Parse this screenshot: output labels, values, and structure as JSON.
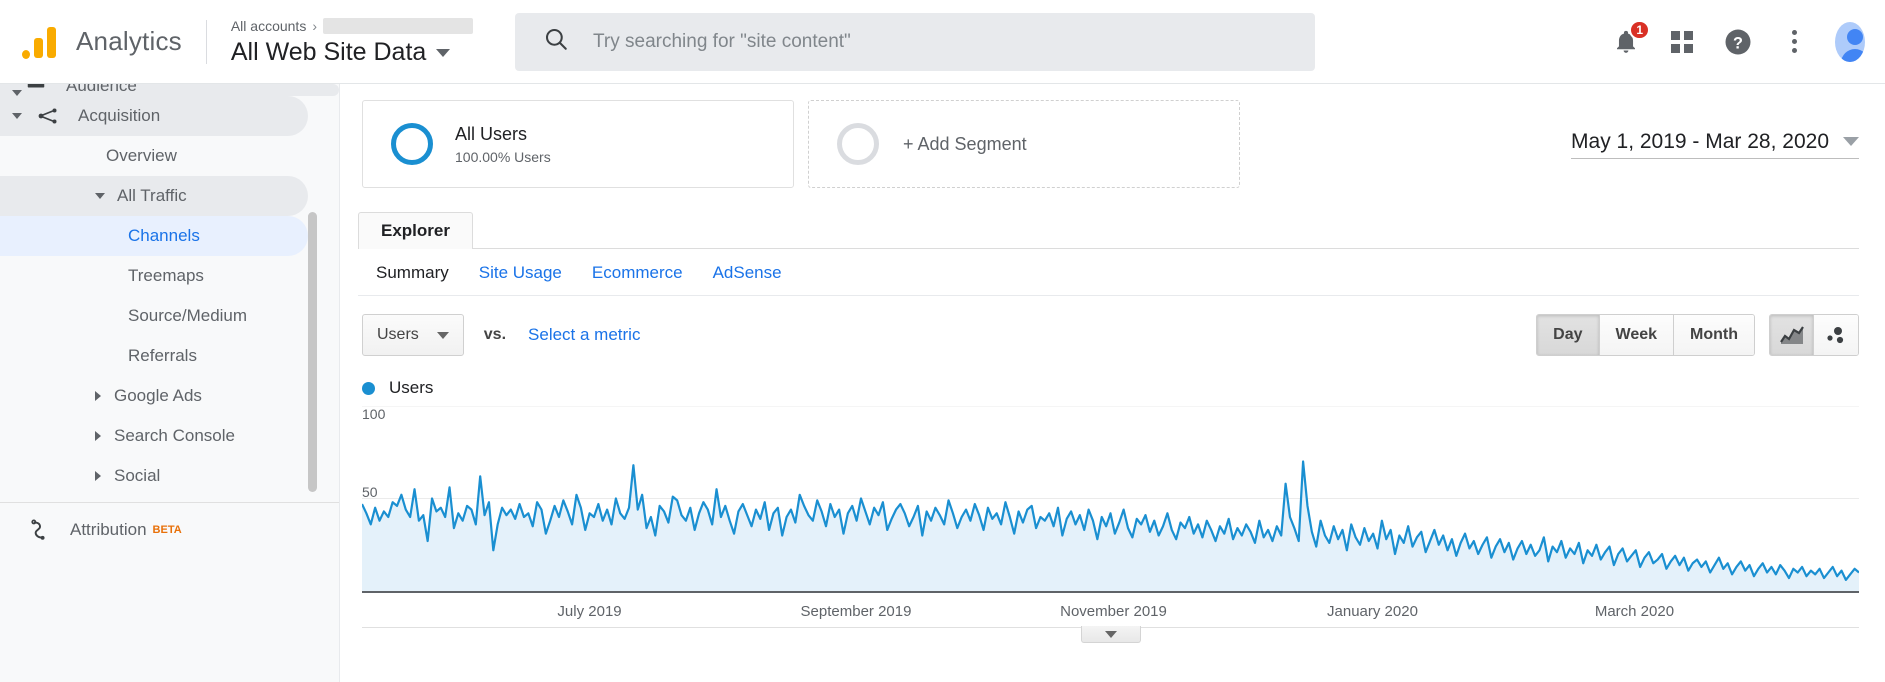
{
  "header": {
    "brand": "Analytics",
    "logo_icon": "analytics-logo",
    "breadcrumb_root": "All accounts",
    "breadcrumb_separator": "›",
    "property_name": "All Web Site Data",
    "search_placeholder": "Try searching for \"site content\"",
    "search_value": "",
    "search_icon": "search-icon",
    "notifications_icon": "bell-icon",
    "notifications_count": "1",
    "apps_icon": "grid-apps-icon",
    "help_icon": "help-question-icon",
    "more_icon": "kebab-menu-icon",
    "account_icon": "user-avatar-icon"
  },
  "sidebar": {
    "cut_top_item": "Audience",
    "items": [
      {
        "label": "Acquisition",
        "level": 0,
        "state": "group",
        "expander": "caret-down",
        "icon": "acquisition-icon"
      },
      {
        "label": "Overview",
        "level": 1,
        "state": "normal",
        "expander": "none",
        "icon": ""
      },
      {
        "label": "All Traffic",
        "level": 2,
        "state": "group",
        "expander": "caret-down",
        "icon": ""
      },
      {
        "label": "Channels",
        "level": 3,
        "state": "selected",
        "expander": "none",
        "icon": ""
      },
      {
        "label": "Treemaps",
        "level": 3,
        "state": "normal",
        "expander": "none",
        "icon": ""
      },
      {
        "label": "Source/Medium",
        "level": 3,
        "state": "normal",
        "expander": "none",
        "icon": ""
      },
      {
        "label": "Referrals",
        "level": 3,
        "state": "normal",
        "expander": "none",
        "icon": ""
      },
      {
        "label": "Google Ads",
        "level": 2,
        "state": "normal",
        "expander": "caret-right",
        "icon": ""
      },
      {
        "label": "Search Console",
        "level": 2,
        "state": "normal",
        "expander": "caret-right",
        "icon": ""
      },
      {
        "label": "Social",
        "level": 2,
        "state": "normal",
        "expander": "caret-right",
        "icon": ""
      }
    ],
    "footer_item": {
      "label": "Attribution",
      "badge": "BETA",
      "icon": "attribution-icon"
    }
  },
  "segments": {
    "primary": {
      "name": "All Users",
      "detail": "100.00% Users",
      "ring_color": "#1a8fd1"
    },
    "add_label": "+ Add Segment"
  },
  "date_range": {
    "label": "May 1, 2019 - Mar 28, 2020",
    "caret": "chevron-down-icon"
  },
  "tabs": {
    "main": "Explorer",
    "sub": [
      "Summary",
      "Site Usage",
      "Ecommerce",
      "AdSense"
    ],
    "sub_active": "Summary"
  },
  "controls": {
    "metric_label": "Users",
    "vs_label": "vs.",
    "select_metric_label": "Select a metric",
    "granularity": [
      "Day",
      "Week",
      "Month"
    ],
    "granularity_active": "Day",
    "chart_types": [
      "line-chart-icon",
      "motion-chart-icon"
    ],
    "chart_type_active": "line-chart-icon"
  },
  "chart_data": {
    "type": "line",
    "title": "Users",
    "legend": [
      "Users"
    ],
    "legend_position": "top-left",
    "series_color": "#1a8fd1",
    "fill_color": "#e4f1fa",
    "xlabel": "",
    "ylabel": "",
    "ylim": [
      0,
      100
    ],
    "yticks": [
      50,
      100
    ],
    "grid": true,
    "x_tick_labels": [
      "July 2019",
      "September 2019",
      "November 2019",
      "January 2020",
      "March 2020"
    ],
    "x_tick_positions_pct": [
      15.2,
      33.0,
      50.2,
      67.5,
      85.0
    ],
    "x_range": [
      "May 1, 2019",
      "Mar 28, 2020"
    ],
    "values": [
      47,
      42,
      36,
      45,
      38,
      43,
      40,
      48,
      46,
      52,
      44,
      40,
      55,
      38,
      41,
      27,
      50,
      43,
      45,
      40,
      56,
      34,
      42,
      38,
      46,
      44,
      36,
      62,
      41,
      48,
      22,
      36,
      45,
      41,
      44,
      39,
      47,
      40,
      42,
      35,
      48,
      44,
      31,
      38,
      46,
      40,
      49,
      43,
      36,
      52,
      45,
      33,
      42,
      40,
      47,
      38,
      44,
      36,
      50,
      42,
      39,
      45,
      68,
      44,
      52,
      34,
      40,
      30,
      46,
      43,
      37,
      51,
      49,
      41,
      38,
      45,
      33,
      42,
      48,
      44,
      36,
      55,
      40,
      46,
      38,
      31,
      43,
      47,
      41,
      35,
      44,
      39,
      48,
      33,
      42,
      45,
      30,
      40,
      44,
      37,
      52,
      46,
      41,
      38,
      49,
      43,
      35,
      47,
      40,
      44,
      31,
      42,
      46,
      38,
      50,
      43,
      36,
      45,
      41,
      48,
      33,
      39,
      44,
      47,
      42,
      35,
      40,
      46,
      30,
      43,
      38,
      45,
      41,
      36,
      49,
      42,
      34,
      40,
      44,
      38,
      47,
      41,
      33,
      45,
      39,
      42,
      36,
      48,
      40,
      31,
      43,
      37,
      44,
      46,
      34,
      40,
      38,
      42,
      35,
      45,
      30,
      39,
      43,
      36,
      41,
      33,
      44,
      38,
      28,
      40,
      35,
      42,
      31,
      37,
      44,
      34,
      29,
      39,
      36,
      41,
      32,
      38,
      30,
      35,
      42,
      33,
      28,
      37,
      34,
      40,
      31,
      36,
      29,
      38,
      33,
      27,
      35,
      31,
      39,
      28,
      34,
      30,
      36,
      32,
      26,
      38,
      29,
      33,
      27,
      35,
      30,
      58,
      40,
      34,
      27,
      70,
      46,
      32,
      24,
      38,
      30,
      26,
      35,
      28,
      33,
      22,
      36,
      29,
      25,
      34,
      27,
      31,
      23,
      38,
      28,
      33,
      20,
      30,
      26,
      35,
      24,
      29,
      32,
      21,
      27,
      33,
      25,
      30,
      22,
      28,
      19,
      26,
      31,
      23,
      27,
      20,
      25,
      29,
      18,
      24,
      28,
      21,
      26,
      17,
      23,
      27,
      20,
      25,
      19,
      22,
      29,
      16,
      24,
      21,
      27,
      18,
      23,
      20,
      26,
      15,
      22,
      19,
      25,
      17,
      21,
      24,
      14,
      20,
      23,
      16,
      19,
      22,
      13,
      18,
      21,
      15,
      17,
      20,
      12,
      16,
      19,
      14,
      18,
      11,
      15,
      17,
      13,
      16,
      10,
      14,
      18,
      12,
      15,
      9,
      13,
      16,
      11,
      14,
      8,
      12,
      15,
      10,
      13,
      9,
      14,
      11,
      7,
      12,
      10,
      13,
      8,
      11,
      9,
      12,
      7,
      10,
      13,
      8,
      11,
      6,
      9,
      12,
      10
    ]
  }
}
